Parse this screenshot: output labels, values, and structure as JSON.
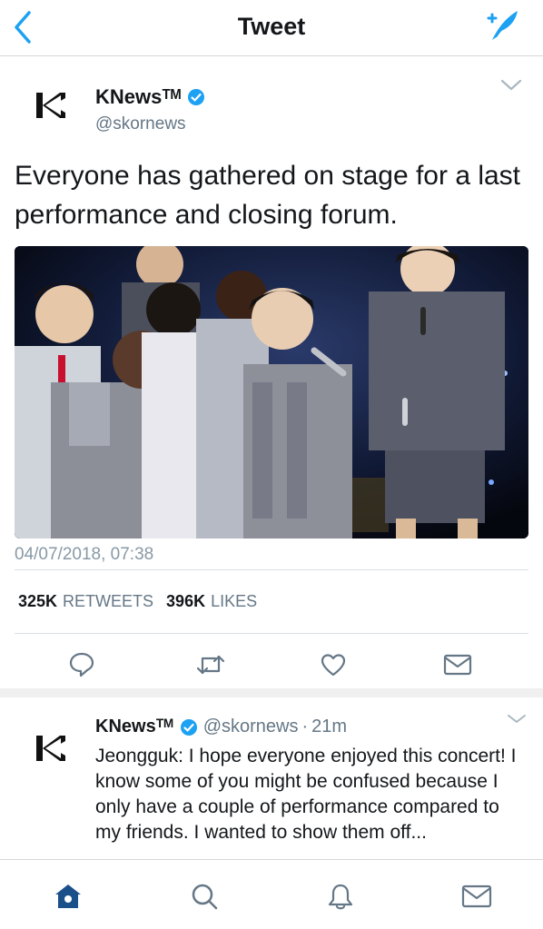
{
  "nav": {
    "title": "Tweet"
  },
  "tweet": {
    "display_name": "KNewsᵀᴹ",
    "handle": "@skornews",
    "text": "Everyone has gathered on stage for a last performance and closing forum.",
    "timestamp": "04/07/2018, 07:38",
    "retweets_count": "325K",
    "retweets_label": "RETWEETS",
    "likes_count": "396K",
    "likes_label": "LIKES"
  },
  "reply": {
    "display_name": "KNewsᵀᴹ",
    "handle": "@skornews",
    "separator": "·",
    "time": "21m",
    "text": "Jeongguk: I hope everyone enjoyed this concert! I know some of you might be confused because I only have a couple of performance compared to my friends. I wanted to show them off..."
  },
  "icons": {
    "back": "chevron-left-icon",
    "compose": "compose-feather-icon",
    "verified": "verified-badge-icon",
    "caret": "chevron-down-icon",
    "reply": "reply-bubble-icon",
    "retweet": "retweet-icon",
    "like": "heart-icon",
    "dm": "envelope-icon",
    "home": "home-icon",
    "search": "search-icon",
    "notifications": "bell-icon",
    "messages": "envelope-icon"
  },
  "colors": {
    "accent": "#1da1f2",
    "tab_active": "#1b4f8a",
    "text_primary": "#14171a",
    "text_secondary": "#657786",
    "verified": "#1da1f2"
  }
}
